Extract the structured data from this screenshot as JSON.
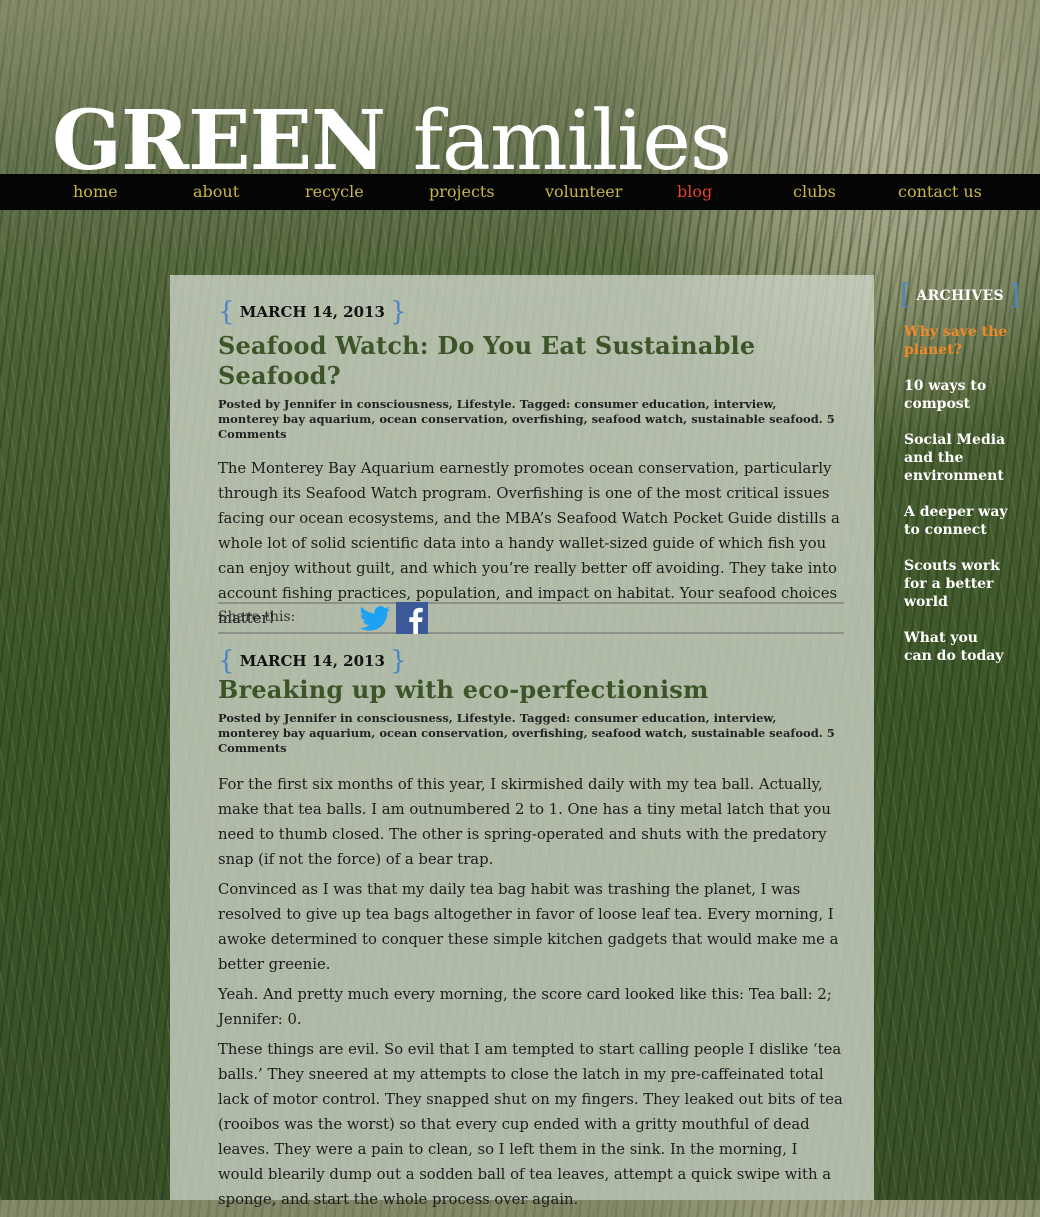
{
  "site": {
    "title_bold": "GREEN",
    "title_light": "families"
  },
  "nav": {
    "items": [
      {
        "label": "home"
      },
      {
        "label": "about"
      },
      {
        "label": "recycle"
      },
      {
        "label": "projects"
      },
      {
        "label": "volunteer"
      },
      {
        "label": "blog",
        "active": true
      },
      {
        "label": "clubs"
      },
      {
        "label": "contact us"
      }
    ],
    "colors": {
      "default": "#c9b64a",
      "active": "#e8402a",
      "bar": "#050505"
    }
  },
  "posts": [
    {
      "date": "MARCH 14, 2013",
      "title": "Seafood Watch: Do You Eat Sustainable Seafood?",
      "meta": "Posted by Jennifer in consciousness, Lifestyle. Tagged: consumer education, interview, monterey bay aquarium, ocean conservation, overfishing, seafood watch, sustainable seafood. 5 Comments",
      "paragraphs": [
        "The Monterey Bay Aquarium earnestly promotes ocean conservation, particularly through its Seafood Watch program. Overfishing is one of the most critical issues facing our ocean ecosystems, and the MBA’s Seafood Watch Pocket Guide distills a whole lot of solid scientific data into a handy wallet-sized guide of which fish you can enjoy without guilt, and which you’re really better off avoiding. They take into account fishing practices, population, and impact on habitat. Your seafood choices matter!"
      ]
    },
    {
      "date": "MARCH 14, 2013",
      "title": "Breaking up with eco-perfectionism",
      "meta": "Posted by Jennifer in consciousness, Lifestyle. Tagged: consumer education, interview, monterey bay aquarium, ocean conservation, overfishing, seafood watch, sustainable seafood. 5 Comments",
      "paragraphs": [
        "For the first six months of this year, I skirmished daily with my tea ball. Actually, make that tea balls. I am outnumbered 2 to 1. One has a tiny metal latch that you need to thumb closed. The other is spring-operated and shuts with the predatory snap (if not the force) of a bear trap.",
        "Convinced as I was that my daily tea bag habit was trashing the planet, I was resolved to give up tea bags altogether in favor of loose leaf tea. Every morning, I awoke determined to conquer these simple kitchen gadgets that would make me a better greenie.",
        "Yeah. And pretty much every morning, the score card looked like this: Tea ball: 2; Jennifer: 0.",
        "These things are evil.  So evil that I am tempted to start calling people I dislike ‘tea balls.’ They sneered at my attempts to close the latch in my pre-caffeinated total lack of motor control. They snapped shut on my fingers. They leaked out bits of tea (rooibos was the worst) so that every cup ended with a gritty mouthful of dead leaves. They were a pain to clean, so I left them in the sink. In the morning, I would blearily dump out a sodden ball of tea leaves, attempt a quick swipe with a sponge, and start the whole process over again."
      ]
    }
  ],
  "share": {
    "label": "Share this:",
    "buttons": [
      {
        "icon": "twitter-icon",
        "color": "#1da1f2"
      },
      {
        "icon": "facebook-icon",
        "color": "#3b5998"
      }
    ]
  },
  "sidebar": {
    "heading": "ARCHIVES",
    "links": [
      {
        "label": "Why save the planet?"
      },
      {
        "label": "10 ways to compost"
      },
      {
        "label": "Social Media and the environment"
      },
      {
        "label": "A deeper way to connect"
      },
      {
        "label": "Scouts work for a better world"
      },
      {
        "label": "What you can do today"
      }
    ]
  },
  "colors": {
    "brace": "#4a86c5",
    "post_title": "#3d5428",
    "sidebar_highlight": "#ee8a2b"
  }
}
